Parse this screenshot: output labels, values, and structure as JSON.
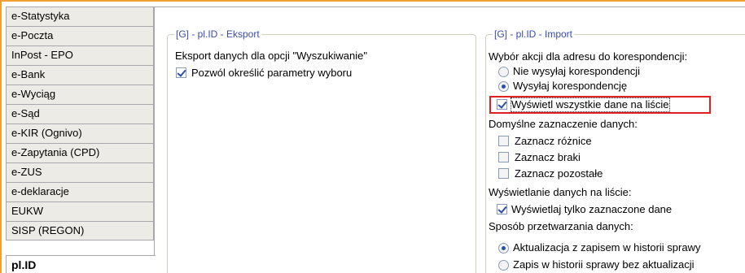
{
  "sidebar": {
    "items": [
      {
        "label": "e-Statystyka"
      },
      {
        "label": "e-Poczta"
      },
      {
        "label": "InPost - EPO"
      },
      {
        "label": "e-Bank"
      },
      {
        "label": "e-Wyciąg"
      },
      {
        "label": "e-Sąd"
      },
      {
        "label": "e-KIR (Ognivo)"
      },
      {
        "label": "e-Zapytania (CPD)"
      },
      {
        "label": "e-ZUS"
      },
      {
        "label": "e-deklaracje"
      },
      {
        "label": "EUKW"
      },
      {
        "label": "SISP (REGON)"
      },
      {
        "label": "pl.ID"
      }
    ],
    "active": "pl.ID"
  },
  "export": {
    "title": "[G] - pl.ID - Eksport",
    "subtitle": "Eksport danych dla opcji \"Wyszukiwanie\"",
    "allow_params": {
      "label": "Pozwól określić parametry wyboru",
      "checked": true
    }
  },
  "import": {
    "title": "[G] - pl.ID - Import",
    "address_action_label": "Wybór akcji dla adresu do korespondencji:",
    "no_send": {
      "label": "Nie wysyłaj korespondencji",
      "checked": false
    },
    "send": {
      "label": "Wysyłaj korespondencję",
      "checked": true
    },
    "show_all": {
      "label": "Wyświetl wszystkie dane na liście",
      "checked": true
    },
    "default_selection_label": "Domyślne zaznaczenie danych:",
    "mark_diff": {
      "label": "Zaznacz różnice",
      "checked": false
    },
    "mark_missing": {
      "label": "Zaznacz braki",
      "checked": false
    },
    "mark_rest": {
      "label": "Zaznacz pozostałe",
      "checked": false
    },
    "display_label": "Wyświetlanie danych na liście:",
    "show_selected": {
      "label": "Wyświetlaj tylko zaznaczone dane",
      "checked": true
    },
    "processing_label": "Sposób przetwarzania danych:",
    "update_history": {
      "label": "Aktualizacja z zapisem w historii sprawy",
      "checked": true
    },
    "history_only": {
      "label": "Zapis w historii sprawy bez aktualizacji",
      "checked": false
    }
  },
  "colors": {
    "group_title": "#3a4ab0",
    "highlight": "#e02020",
    "accent_border": "#f0a030"
  }
}
